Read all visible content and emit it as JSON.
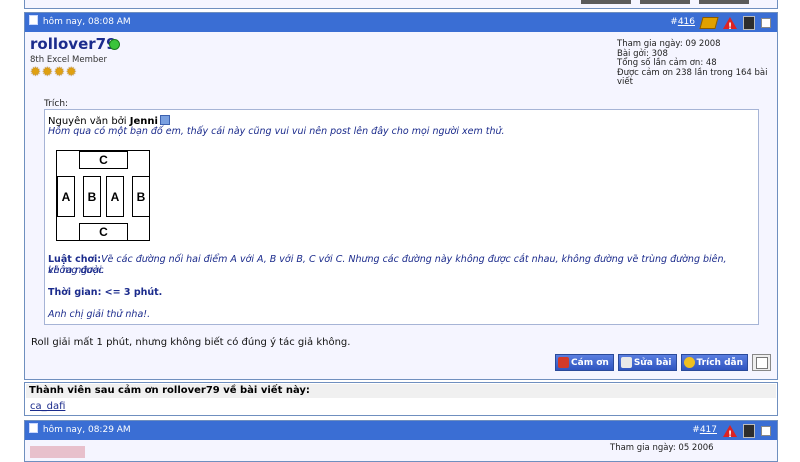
{
  "post416": {
    "date": "hôm nay, 08:08 AM",
    "number_prefix": "#",
    "number": "416",
    "username": "rollover79",
    "user_title": "8th Excel Member",
    "star_count": 4,
    "stats": [
      "Tham gia ngày: 09 2008",
      "Bài gởi: 308",
      "Tổng số lần cảm ơn: 48",
      "Được cảm ơn 238 lần trong 164 bài viết"
    ],
    "quote_label": "Trích:",
    "quote_author_prefix": "Nguyên văn bởi ",
    "quote_author": "Jenni",
    "quote_line1": "Hôm qua có một bạn đố em, thấy cái này cũng vui vui nên post lên đây cho mọi người xem thử.",
    "puzzle_letters": {
      "top": "C",
      "bottom": "C",
      "a1": "A",
      "b1": "B",
      "a2": "A",
      "b2": "B"
    },
    "rule_label": "Luật chơi:",
    "rule_text": "Vẽ các đường nối hai điểm A với A, B với B, C với C. Nhưng các đường này không được cắt nhau, không đường vẽ trùng đường biên, không được",
    "rule_text2": "vẽ ra ngoài.",
    "time_label": "Thời gian: <= 3 phút.",
    "closing": "Anh chị giải thử nha!.",
    "reply": "Roll giải mất 1 phút, nhưng không biết có đúng ý tác giả không.",
    "buttons": {
      "thank": "Cám ơn",
      "edit": "Sửa bài",
      "quote": "Trích dẫn"
    },
    "thanks_title": "Thành viên sau cảm ơn rollover79 về bài viết này:",
    "thanks_user": "ca_dafi"
  },
  "post417": {
    "date": "hôm nay, 08:29 AM",
    "number_prefix": "#",
    "number": "417",
    "stats_first": "Tham gia ngày: 05 2006"
  }
}
